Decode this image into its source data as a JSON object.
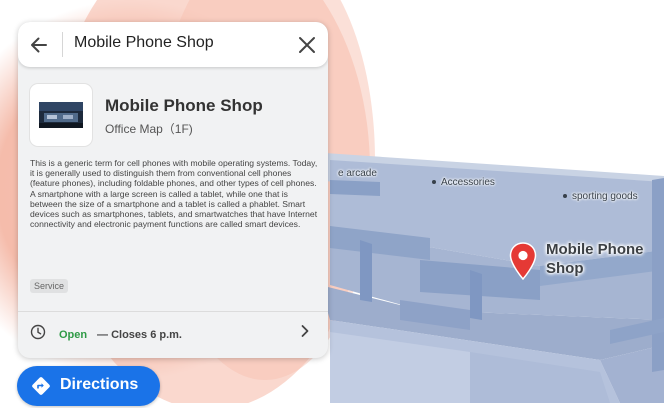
{
  "search": {
    "value": "Mobile Phone Shop",
    "back_icon": "arrow-left-icon",
    "close_icon": "close-icon"
  },
  "place": {
    "name": "Mobile Phone Shop",
    "location": "Office Map（1F)",
    "description": "This is a generic term for cell phones with mobile operating systems. Today, it is generally used to distinguish them from conventional cell phones (feature phones), including foldable phones, and other types of cell phones. A smartphone with a large screen is called a tablet, while one that is between the size of a smartphone and a tablet is called a phablet. Smart devices such as smartphones, tablets, and smartwatches that have Internet connectivity and electronic payment functions are called smart devices.",
    "category_tag": "Service",
    "hours": {
      "status": "Open",
      "separator": "—",
      "closes": "Closes 6 p.m."
    }
  },
  "map": {
    "labels": [
      "e arcade",
      "Accessories",
      "sporting goods"
    ],
    "pin_label": "Mobile Phone Shop",
    "pin_color": "#e53935"
  },
  "directions": {
    "label": "Directions",
    "color": "#1a73e8"
  },
  "colors": {
    "open_green": "#2e9a45",
    "floor": "#aab9d6",
    "highlight": "#f3a48a"
  }
}
